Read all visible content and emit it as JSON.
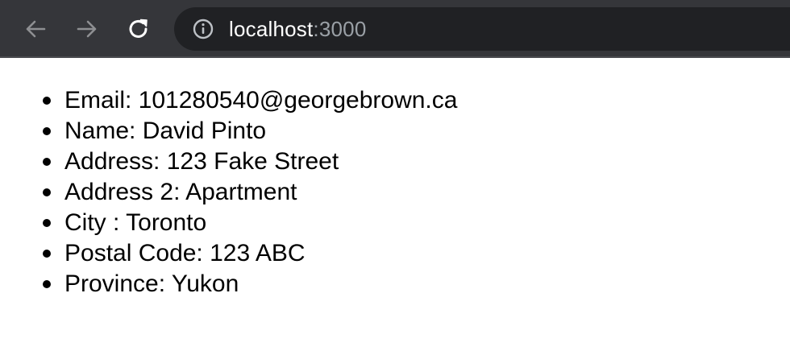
{
  "browser": {
    "url_host": "localhost",
    "url_port": ":3000",
    "icons": {
      "back": "arrow-left-icon",
      "forward": "arrow-right-icon",
      "reload": "reload-icon",
      "site_info": "info-circle-icon"
    }
  },
  "page": {
    "items": [
      "Email: 101280540@georgebrown.ca",
      "Name: David Pinto",
      "Address: 123 Fake Street",
      "Address 2: Apartment",
      "City : Toronto",
      "Postal Code: 123 ABC",
      "Province: Yukon"
    ]
  },
  "colors": {
    "toolbar_bg": "#35363a",
    "omnibox_bg": "#202124",
    "url_host": "#ffffff",
    "url_port": "#9aa0a6",
    "page_bg": "#ffffff",
    "text": "#000000"
  }
}
